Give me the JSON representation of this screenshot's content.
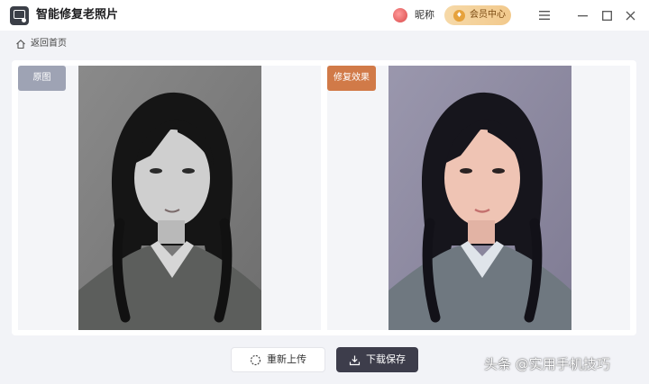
{
  "app": {
    "title": "智能修复老照片"
  },
  "header": {
    "nickname": "昵称",
    "vip_label": "会员中心"
  },
  "nav": {
    "back_label": "返回首页"
  },
  "panels": {
    "original_tag": "原图",
    "repaired_tag": "修复效果"
  },
  "actions": {
    "reupload_label": "重新上传",
    "download_label": "下载保存"
  },
  "watermark": {
    "text": "头条 @实用手机技巧"
  },
  "colors": {
    "repaired_tag_bg": "#d17a48",
    "original_tag_bg": "#9ea3b4",
    "download_btn_bg": "#3d3d4b",
    "vip_gold": "#f2c98c"
  }
}
